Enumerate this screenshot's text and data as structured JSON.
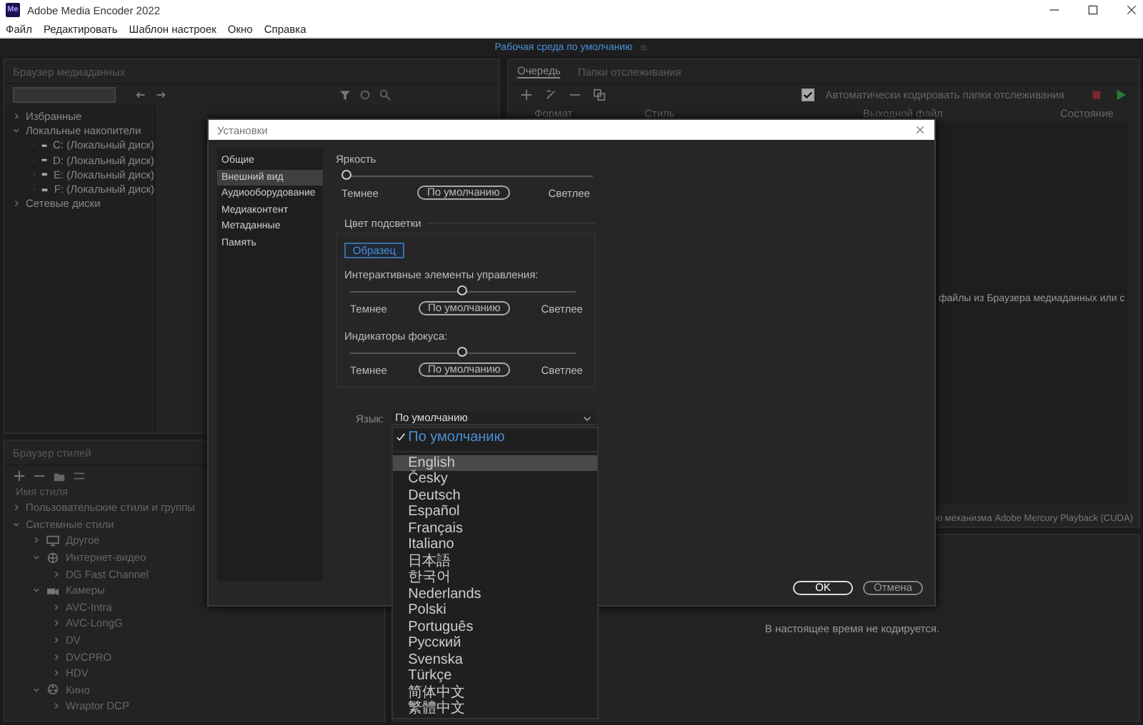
{
  "window": {
    "app_icon": "Me",
    "title": "Adobe Media Encoder 2022"
  },
  "menu": [
    "Файл",
    "Редактировать",
    "Шаблон настроек",
    "Окно",
    "Справка"
  ],
  "workspace": {
    "label": "Рабочая среда по умолчанию"
  },
  "media_browser": {
    "title": "Браузер медиаданных",
    "tree": [
      {
        "label": "Избранные",
        "expanded": false
      },
      {
        "label": "Локальные накопители",
        "expanded": true,
        "children": [
          {
            "label": "C: (Локальный диск)",
            "kind": "drive",
            "expanded": false
          },
          {
            "label": "D: (Локальный диск)",
            "kind": "drive",
            "expanded": false
          },
          {
            "label": "E: (Локальный диск)",
            "kind": "drive",
            "expanded": false
          },
          {
            "label": "F: (Локальный диск)",
            "kind": "drive",
            "expanded": false
          }
        ]
      },
      {
        "label": "Сетевые диски",
        "expanded": false
      }
    ]
  },
  "queue": {
    "tabs": [
      {
        "label": "Очередь",
        "selected": true
      },
      {
        "label": "Папки отслеживания",
        "selected": false
      }
    ],
    "auto_encode": {
      "label": "Автоматически кодировать папки отслеживания",
      "checked": true
    },
    "columns": [
      "Формат",
      "Стиль",
      "Выходной файл",
      "Состояние"
    ],
    "hint": "файлы из Браузера медиаданных или с"
  },
  "renderer": "ю механизма Adobe Mercury Playback (CUDA)",
  "preset_browser": {
    "title": "Браузер стилей",
    "column": "Имя стиля",
    "tree": [
      {
        "label": "Пользовательские стили и группы",
        "expanded": false
      },
      {
        "label": "Системные стили",
        "expanded": true,
        "children": [
          {
            "label": "Другое",
            "kind": "monitor",
            "expanded": false
          },
          {
            "label": "Интернет-видео",
            "kind": "globe",
            "expanded": true,
            "children": [
              {
                "label": "DG Fast Channel",
                "expanded": false
              }
            ]
          },
          {
            "label": "Камеры",
            "kind": "camera",
            "expanded": true,
            "children": [
              {
                "label": "AVC-Intra",
                "expanded": false
              },
              {
                "label": "AVC-LongG",
                "expanded": false
              },
              {
                "label": "DV",
                "expanded": false
              },
              {
                "label": "DVCPRO",
                "expanded": false
              },
              {
                "label": "HDV",
                "expanded": false
              }
            ]
          },
          {
            "label": "Кино",
            "kind": "reel",
            "expanded": true,
            "children": [
              {
                "label": "Wraptor DCP",
                "expanded": false
              }
            ]
          }
        ]
      }
    ]
  },
  "encoding": {
    "status": "В настоящее время не кодируется."
  },
  "dialog": {
    "title": "Установки",
    "nav": [
      {
        "label": "Общие",
        "selected": false
      },
      {
        "label": "Внешний вид",
        "selected": true
      },
      {
        "label": "Аудиооборудование",
        "selected": false
      },
      {
        "label": "Медиаконтент",
        "selected": false
      },
      {
        "label": "Метаданные",
        "selected": false
      },
      {
        "label": "Память",
        "selected": false
      }
    ],
    "brightness": {
      "label": "Яркость",
      "level": 0,
      "darker": "Темнее",
      "default": "По умолчанию",
      "lighter": "Светлее"
    },
    "highlight": {
      "title": "Цвет подсветки",
      "sample": "Образец",
      "sliders": [
        {
          "label": "Интерактивные элементы управления:",
          "level": 0.5,
          "darker": "Темнее",
          "default": "По умолчанию",
          "lighter": "Светлее"
        },
        {
          "label": "Индикаторы фокуса:",
          "level": 0.5,
          "darker": "Темнее",
          "default": "По умолчанию",
          "lighter": "Светлее"
        }
      ]
    },
    "language": {
      "label": "Язык:",
      "value": "По умолчанию",
      "options": [
        {
          "label": "По умолчанию",
          "selected": true,
          "hovered": false
        },
        {
          "label": "English",
          "selected": false,
          "hovered": true
        },
        {
          "label": "Česky",
          "selected": false,
          "hovered": false
        },
        {
          "label": "Deutsch",
          "selected": false,
          "hovered": false
        },
        {
          "label": "Español",
          "selected": false,
          "hovered": false
        },
        {
          "label": "Français",
          "selected": false,
          "hovered": false
        },
        {
          "label": "Italiano",
          "selected": false,
          "hovered": false
        },
        {
          "label": "日本語",
          "selected": false,
          "hovered": false
        },
        {
          "label": "한국어",
          "selected": false,
          "hovered": false
        },
        {
          "label": "Nederlands",
          "selected": false,
          "hovered": false
        },
        {
          "label": "Polski",
          "selected": false,
          "hovered": false
        },
        {
          "label": "Português",
          "selected": false,
          "hovered": false
        },
        {
          "label": "Русский",
          "selected": false,
          "hovered": false
        },
        {
          "label": "Svenska",
          "selected": false,
          "hovered": false
        },
        {
          "label": "Türkçe",
          "selected": false,
          "hovered": false
        },
        {
          "label": "简体中文",
          "selected": false,
          "hovered": false
        },
        {
          "label": "繁體中文",
          "selected": false,
          "hovered": false
        }
      ]
    },
    "buttons": [
      "OK",
      "Отмена"
    ]
  }
}
